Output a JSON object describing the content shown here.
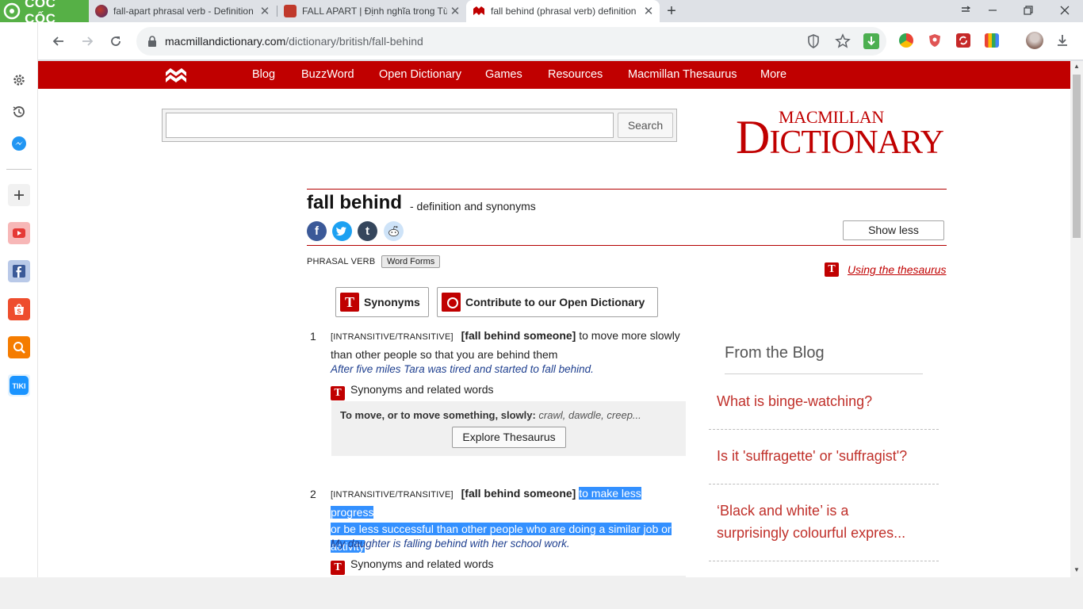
{
  "browser": {
    "brand_label": "CỐC CỐC",
    "tabs": [
      {
        "title": "fall-apart phrasal verb - Definition",
        "active": false
      },
      {
        "title": "FALL APART | Định nghĩa trong Từ",
        "active": false
      },
      {
        "title": "fall behind (phrasal verb) definition",
        "active": true
      }
    ],
    "url_domain": "macmillandictionary.com",
    "url_path": "/dictionary/british/fall-behind",
    "new_tab_glyph": "+",
    "close_glyph": "✕"
  },
  "site": {
    "nav": [
      "Blog",
      "BuzzWord",
      "Open Dictionary",
      "Games",
      "Resources",
      "Macmillan Thesaurus",
      "More"
    ],
    "search": {
      "value": "",
      "button": "Search"
    },
    "brand_top": "MACMILLAN",
    "brand_main_first": "D",
    "brand_main_rest": "ICTIONARY",
    "brand_color": "#c00000"
  },
  "entry": {
    "headword": "fall behind",
    "subtitle": "- definition and synonyms",
    "show_less": "Show less",
    "part_of_speech": "PHRASAL VERB",
    "word_forms": "Word Forms",
    "thesaurus_link": "Using the thesaurus",
    "synonyms_button": "Synonyms",
    "contribute_button": "Contribute to our Open Dictionary",
    "senses": [
      {
        "number": "1",
        "grammar": "[INTRANSITIVE/TRANSITIVE]",
        "pattern": "[fall behind someone]",
        "definition_first": "to move more slowly",
        "definition_rest": "than other people so that you are behind them",
        "example": "After five miles Tara was tired and started to fall behind.",
        "synonyms_label": "Synonyms and related words",
        "thesaurus_prompt": "To move, or to move something, slowly:",
        "thesaurus_words": "crawl, dawdle, creep...",
        "explore_button": "Explore Thesaurus"
      },
      {
        "number": "2",
        "grammar": "[INTRANSITIVE/TRANSITIVE]",
        "pattern": "[fall behind someone]",
        "definition_line1": "to make less progress",
        "definition_line2": "or be less successful than other people who are doing a similar job or",
        "definition_line3": "activity",
        "example": "My daughter is falling behind with her school work.",
        "synonyms_label": "Synonyms and related words"
      }
    ]
  },
  "blog": {
    "heading": "From the Blog",
    "items": [
      {
        "line1": "What is binge-watching?",
        "line2": ""
      },
      {
        "line1": "Is it 'suffragette' or 'suffragist'?",
        "line2": ""
      },
      {
        "line1": "‘Black and white’ is a",
        "line2": "surprisingly colourful expres..."
      }
    ]
  },
  "colors": {
    "nav_red": "#c00000",
    "selection": "#3390ff",
    "example_blue": "#1e3f8f",
    "blog_red": "#c0302a",
    "coccoc_green": "#56b046"
  }
}
